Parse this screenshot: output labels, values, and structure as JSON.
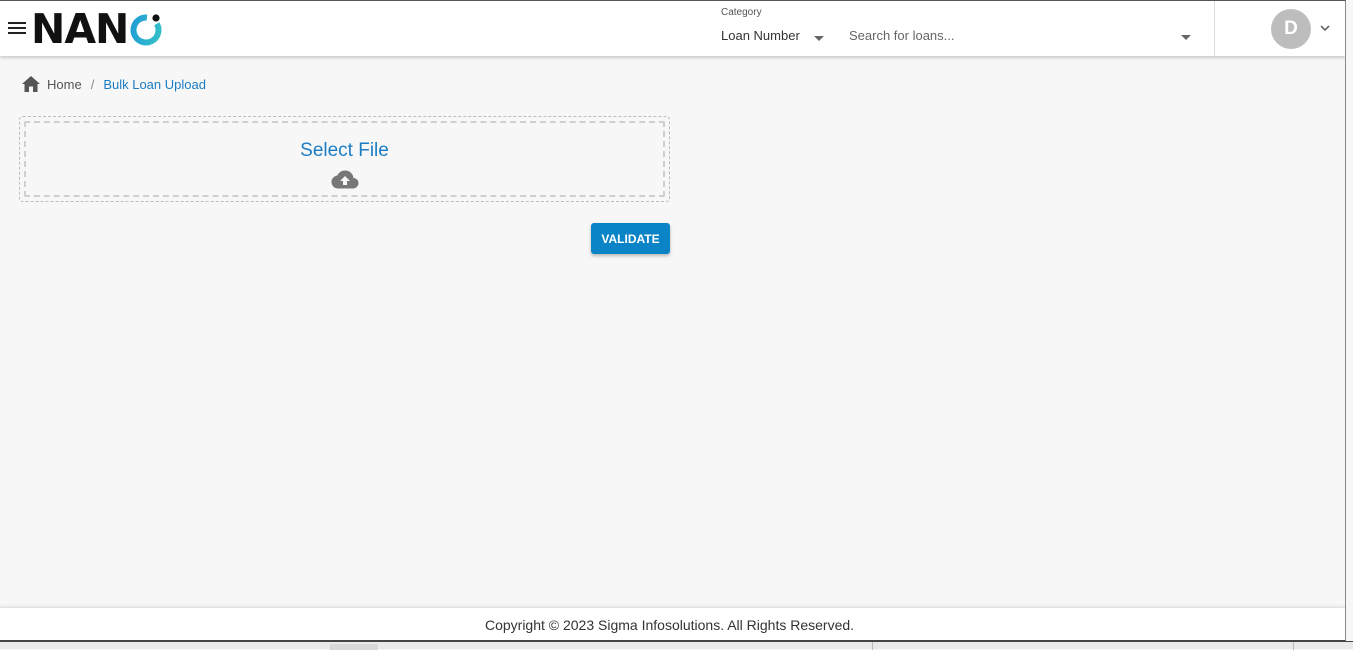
{
  "header": {
    "logo_text": "NAN",
    "category": {
      "label": "Category",
      "value": "Loan Number"
    },
    "search": {
      "placeholder": "Search for loans..."
    },
    "avatar_initial": "D"
  },
  "breadcrumb": {
    "home": "Home",
    "separator": "/",
    "current": "Bulk Loan Upload"
  },
  "upload": {
    "title": "Select File",
    "icon": "cloud-upload-icon"
  },
  "actions": {
    "validate_label": "VALIDATE"
  },
  "footer": {
    "copyright": "Copyright © 2023 Sigma Infosolutions. All Rights Reserved."
  },
  "colors": {
    "accent": "#1a7dc4",
    "button": "#0a84c6",
    "logo_ring_start": "#1f9bd8",
    "logo_ring_end": "#35c2c7",
    "avatar_bg": "#bdbdbd"
  }
}
